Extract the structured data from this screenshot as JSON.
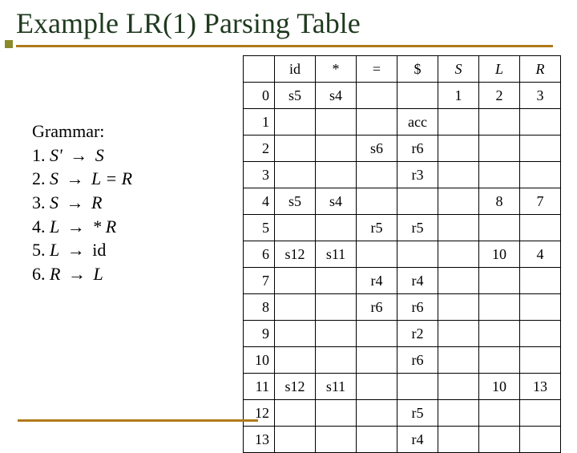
{
  "title": "Example LR(1) Parsing Table",
  "grammar": {
    "heading": "Grammar:",
    "rules": [
      {
        "n": "1.",
        "lhs": "S'",
        "rhs": "S"
      },
      {
        "n": "2.",
        "lhs": "S",
        "rhs": "L = R"
      },
      {
        "n": "3.",
        "lhs": "S",
        "rhs": "R"
      },
      {
        "n": "4.",
        "lhs": "L",
        "rhs": "* R"
      },
      {
        "n": "5.",
        "lhs": "L",
        "rhs": "id"
      },
      {
        "n": "6.",
        "lhs": "R",
        "rhs": "L"
      }
    ],
    "arrow": "→"
  },
  "table": {
    "terminals": [
      "id",
      "*",
      "=",
      "$"
    ],
    "nonterminals": [
      "S",
      "L",
      "R"
    ],
    "rows": [
      {
        "state": "0",
        "id": "s5",
        "star": "s4",
        "eq": "",
        "dollar": "",
        "S": "1",
        "L": "2",
        "R": "3"
      },
      {
        "state": "1",
        "id": "",
        "star": "",
        "eq": "",
        "dollar": "acc",
        "S": "",
        "L": "",
        "R": ""
      },
      {
        "state": "2",
        "id": "",
        "star": "",
        "eq": "s6",
        "dollar": "r6",
        "S": "",
        "L": "",
        "R": ""
      },
      {
        "state": "3",
        "id": "",
        "star": "",
        "eq": "",
        "dollar": "r3",
        "S": "",
        "L": "",
        "R": ""
      },
      {
        "state": "4",
        "id": "s5",
        "star": "s4",
        "eq": "",
        "dollar": "",
        "S": "",
        "L": "8",
        "R": "7"
      },
      {
        "state": "5",
        "id": "",
        "star": "",
        "eq": "r5",
        "dollar": "r5",
        "S": "",
        "L": "",
        "R": ""
      },
      {
        "state": "6",
        "id": "s12",
        "star": "s11",
        "eq": "",
        "dollar": "",
        "S": "",
        "L": "10",
        "R": "4"
      },
      {
        "state": "7",
        "id": "",
        "star": "",
        "eq": "r4",
        "dollar": "r4",
        "S": "",
        "L": "",
        "R": ""
      },
      {
        "state": "8",
        "id": "",
        "star": "",
        "eq": "r6",
        "dollar": "r6",
        "S": "",
        "L": "",
        "R": ""
      },
      {
        "state": "9",
        "id": "",
        "star": "",
        "eq": "",
        "dollar": "r2",
        "S": "",
        "L": "",
        "R": ""
      },
      {
        "state": "10",
        "id": "",
        "star": "",
        "eq": "",
        "dollar": "r6",
        "S": "",
        "L": "",
        "R": ""
      },
      {
        "state": "11",
        "id": "s12",
        "star": "s11",
        "eq": "",
        "dollar": "",
        "S": "",
        "L": "10",
        "R": "13"
      },
      {
        "state": "12",
        "id": "",
        "star": "",
        "eq": "",
        "dollar": "r5",
        "S": "",
        "L": "",
        "R": ""
      },
      {
        "state": "13",
        "id": "",
        "star": "",
        "eq": "",
        "dollar": "r4",
        "S": "",
        "L": "",
        "R": ""
      }
    ]
  }
}
